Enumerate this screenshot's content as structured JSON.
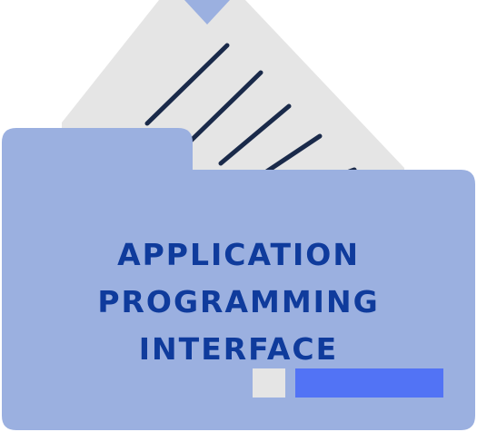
{
  "graphic": {
    "title_line1": "APPLICATION PROGRAMMING",
    "title_line2": "INTERFACE",
    "colors": {
      "folder": "#9bb0e0",
      "paper": "#e5e5e5",
      "paper_lines": "#1a2a4a",
      "paper_tab": "#9bb0e0",
      "title": "#0f3b9c",
      "small_block": "#e5e5e5",
      "bar": "#5273f5"
    },
    "icons": [
      "folder-icon",
      "document-icon"
    ]
  }
}
